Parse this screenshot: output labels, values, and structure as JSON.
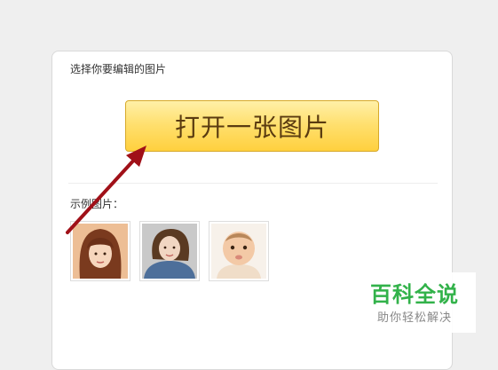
{
  "panel": {
    "prompt": "选择你要编辑的图片",
    "open_button_label": "打开一张图片",
    "examples_label": "示例图片："
  },
  "examples": [
    {
      "icon": "woman-bangs-portrait"
    },
    {
      "icon": "woman-denim-portrait"
    },
    {
      "icon": "baby-portrait"
    }
  ],
  "watermark": {
    "title": "百科全说",
    "subtitle": "助你轻松解决"
  },
  "colors": {
    "button_top": "#fff0a8",
    "button_bottom": "#ffd03e",
    "button_text": "#5a3b10",
    "arrow": "#a01018",
    "watermark_green": "#32b24a"
  }
}
